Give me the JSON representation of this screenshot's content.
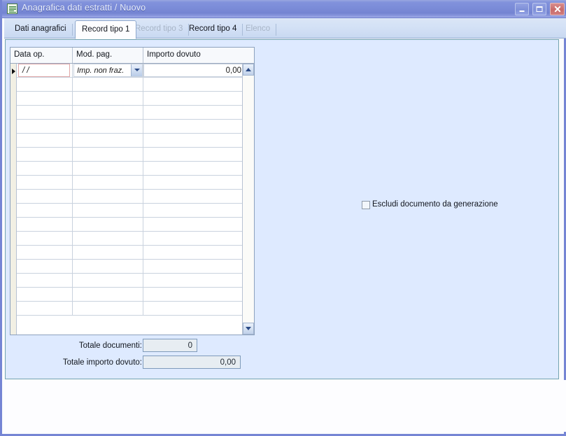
{
  "window": {
    "title": "Anagrafica dati estratti / Nuovo",
    "icon": "document-list-icon",
    "controls": {
      "minimize": "Riduci a icona",
      "maximize": "Ingrandisci",
      "close": "Chiudi"
    },
    "accent_color": "#7b8cd8",
    "client_background": "#deeaff"
  },
  "tabs": [
    {
      "label": "Dati anagrafici",
      "state": "enabled"
    },
    {
      "label": "Record tipo 1",
      "state": "active"
    },
    {
      "label": "Record tipo 3",
      "state": "disabled"
    },
    {
      "label": "Record tipo 4",
      "state": "enabled"
    },
    {
      "label": "Elenco",
      "state": "disabled"
    }
  ],
  "grid": {
    "columns": [
      {
        "label": "Data op."
      },
      {
        "label": "Mod. pag."
      },
      {
        "label": "Importo dovuto"
      }
    ],
    "active_row": {
      "data_op": "/  /",
      "data_op_placeholder": "/  /",
      "mod_pag": "Imp. non fraz.",
      "importo_dovuto": "0,00"
    },
    "empty_row_count": 18,
    "scrollbar": {
      "up_icon": "chevron-up-icon",
      "down_icon": "chevron-down-icon"
    }
  },
  "totals": {
    "documents_label": "Totale documenti:",
    "documents_value": "0",
    "amount_label": "Totale importo dovuto:",
    "amount_value": "0,00"
  },
  "options": {
    "exclude_checkbox_label": "Escludi documento da generazione",
    "exclude_checkbox_checked": false
  }
}
